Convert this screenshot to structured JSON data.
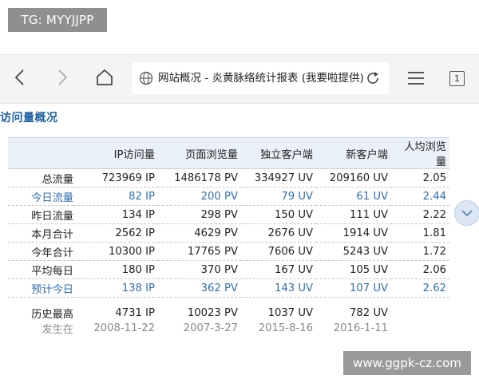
{
  "watermark_top": "TG: MYYJJPP",
  "watermark_bottom": "www.ggpk-cz.com",
  "browser": {
    "address_title": "网站概况 - 炎黄脉络统计报表 (我要啦提供)",
    "tab_count": "1",
    "icons": [
      "back-icon",
      "forward-icon",
      "home-icon",
      "globe-icon",
      "reload-icon",
      "menu-icon",
      "tabs-icon"
    ]
  },
  "section_title": "访问量概况",
  "table": {
    "headers": [
      "",
      "IP访问量",
      "页面浏览量",
      "独立客户端",
      "新客户端",
      "人均浏览量"
    ],
    "rows": [
      {
        "label": "总流量",
        "cells": [
          "723969 IP",
          "1486178 PV",
          "334927 UV",
          "209160 UV",
          "2.05"
        ],
        "highlight": false
      },
      {
        "label": "今日流量",
        "cells": [
          "82 IP",
          "200 PV",
          "79 UV",
          "61 UV",
          "2.44"
        ],
        "highlight": true
      },
      {
        "label": "昨日流量",
        "cells": [
          "134 IP",
          "298 PV",
          "150 UV",
          "111 UV",
          "2.22"
        ],
        "highlight": false
      },
      {
        "label": "本月合计",
        "cells": [
          "2562 IP",
          "4629 PV",
          "2676 UV",
          "1914 UV",
          "1.81"
        ],
        "highlight": false
      },
      {
        "label": "今年合计",
        "cells": [
          "10300 IP",
          "17765 PV",
          "7606 UV",
          "5243 UV",
          "1.72"
        ],
        "highlight": false
      },
      {
        "label": "平均每日",
        "cells": [
          "180 IP",
          "370 PV",
          "167 UV",
          "105 UV",
          "2.06"
        ],
        "highlight": false
      },
      {
        "label": "预计今日",
        "cells": [
          "138 IP",
          "362 PV",
          "143 UV",
          "107 UV",
          "2.62"
        ],
        "highlight": true
      }
    ],
    "history": {
      "label": "历史最高",
      "cells": [
        "4731 IP",
        "10023 PV",
        "1037 UV",
        "782 UV",
        ""
      ]
    },
    "occurred": {
      "label": "发生在",
      "cells": [
        "2008-11-22",
        "2007-3-27",
        "2015-8-16",
        "2016-1-11",
        ""
      ]
    }
  },
  "colors": {
    "accent": "#1d5f9e",
    "highlight_text": "#2f6fae",
    "header_bg": "#eaf0f7"
  }
}
